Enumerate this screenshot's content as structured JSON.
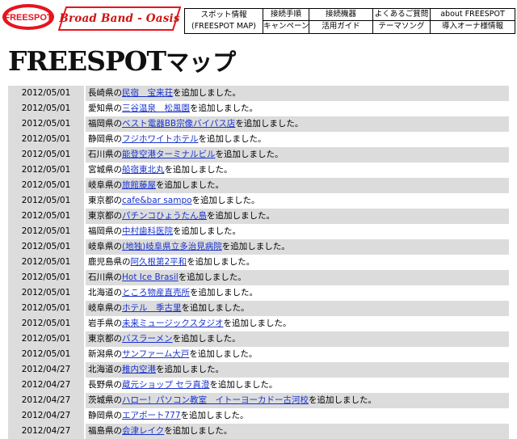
{
  "header": {
    "logo_text": "FREESPOT",
    "tagline": "Broad Band - Oasis",
    "nav": [
      {
        "lines": [
          "スポット情報",
          "(FREESPOT MAP)"
        ]
      },
      {
        "lines": [
          "接続手順"
        ]
      },
      {
        "lines": [
          "接続機器"
        ]
      },
      {
        "lines": [
          "よくあるご質問"
        ]
      },
      {
        "lines": [
          "about FREESPOT"
        ]
      },
      {
        "lines": [
          "キャンペーン"
        ]
      },
      {
        "lines": [
          "活用ガイド"
        ]
      },
      {
        "lines": [
          "テーマソング"
        ]
      },
      {
        "lines": [
          "導入オーナ様情報"
        ]
      }
    ]
  },
  "page": {
    "title_latin": "FREESPOT",
    "title_ja": "マップ"
  },
  "list": {
    "suffix": "を追加しました。",
    "rows": [
      {
        "date": "2012/05/01",
        "pref": "長崎県の",
        "spot": "民宿　宝来荘"
      },
      {
        "date": "2012/05/01",
        "pref": "愛知県の",
        "spot": "三谷温泉　松風園"
      },
      {
        "date": "2012/05/01",
        "pref": "福岡県の",
        "spot": "ベスト電器BB宗像バイパス店"
      },
      {
        "date": "2012/05/01",
        "pref": "静岡県の",
        "spot": "フジホワイトホテル"
      },
      {
        "date": "2012/05/01",
        "pref": "石川県の",
        "spot": "能登空港ターミナルビル"
      },
      {
        "date": "2012/05/01",
        "pref": "宮城県の",
        "spot": "船宿東北丸"
      },
      {
        "date": "2012/05/01",
        "pref": "岐阜県の",
        "spot": "旅館藤屋"
      },
      {
        "date": "2012/05/01",
        "pref": "東京都の",
        "spot": "cafe&bar sampo"
      },
      {
        "date": "2012/05/01",
        "pref": "東京都の",
        "spot": "パチンコひょうたん島"
      },
      {
        "date": "2012/05/01",
        "pref": "福岡県の",
        "spot": "中村歯科医院"
      },
      {
        "date": "2012/05/01",
        "pref": "岐阜県の",
        "spot": "(地独)岐阜県立多治見病院"
      },
      {
        "date": "2012/05/01",
        "pref": "鹿児島県の",
        "spot": "阿久根第2平和"
      },
      {
        "date": "2012/05/01",
        "pref": "石川県の",
        "spot": "Hot Ice Brasil"
      },
      {
        "date": "2012/05/01",
        "pref": "北海道の",
        "spot": "ところ物産直売所"
      },
      {
        "date": "2012/05/01",
        "pref": "岐阜県の",
        "spot": "ホテル　季古里"
      },
      {
        "date": "2012/05/01",
        "pref": "岩手県の",
        "spot": "未来ミュージックスタジオ"
      },
      {
        "date": "2012/05/01",
        "pref": "東京都の",
        "spot": "バスラーメン"
      },
      {
        "date": "2012/05/01",
        "pref": "新潟県の",
        "spot": "サンファーム大戸"
      },
      {
        "date": "2012/04/27",
        "pref": "北海道の",
        "spot": "稚内空港"
      },
      {
        "date": "2012/04/27",
        "pref": "長野県の",
        "spot": "蔵元ショップ セラ真澄"
      },
      {
        "date": "2012/04/27",
        "pref": "茨城県の",
        "spot": "ハロー！パソコン教室　イトーヨーカドー古河校"
      },
      {
        "date": "2012/04/27",
        "pref": "静岡県の",
        "spot": "エアポート777"
      },
      {
        "date": "2012/04/27",
        "pref": "福島県の",
        "spot": "会津レイク"
      }
    ]
  },
  "colors": {
    "brand_red": "#e8141c",
    "link": "#1a33cc",
    "row_gray": "#dcdcdc"
  }
}
